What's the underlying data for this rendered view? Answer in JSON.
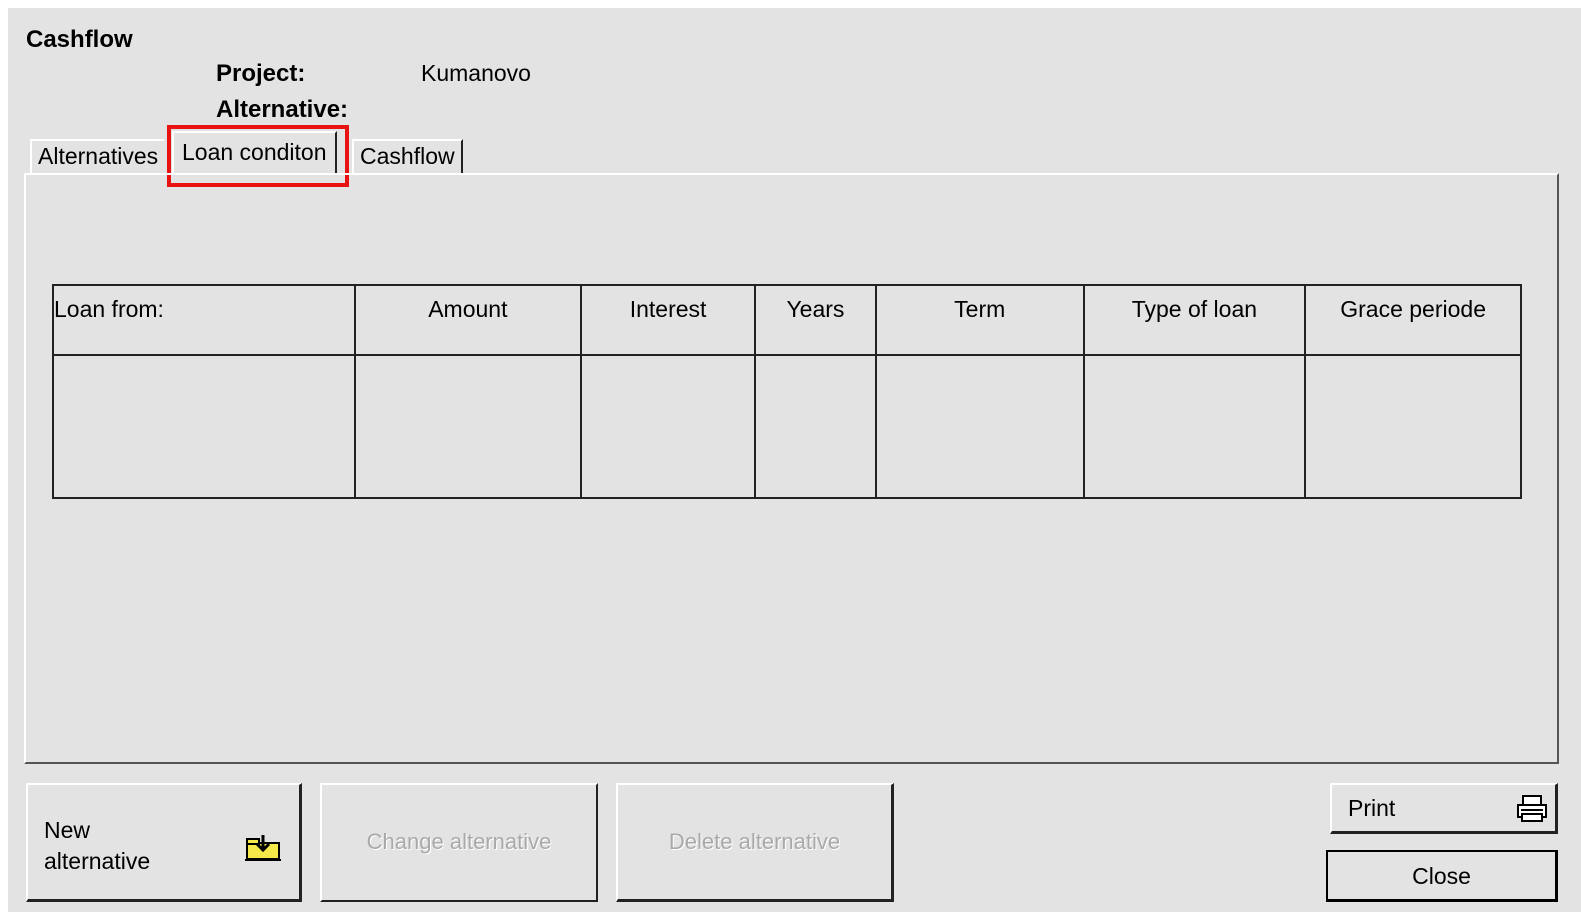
{
  "window": {
    "title": "Cashflow",
    "project_label": "Project:",
    "project_value": "Kumanovo",
    "alternative_label": "Alternative:"
  },
  "tabs": [
    {
      "label": "Alternatives"
    },
    {
      "label": "Loan conditon",
      "active": true
    },
    {
      "label": "Cashflow"
    }
  ],
  "loan_table": {
    "columns": [
      "Loan from:",
      "Amount",
      "Interest",
      "Years",
      "Term",
      "Type of loan",
      "Grace periode"
    ],
    "rows": []
  },
  "buttons": {
    "new_alternative": "New\nalternative",
    "change_alternative": "Change alternative",
    "delete_alternative": "Delete alternative",
    "print": "Print",
    "close": "Close"
  },
  "icons": {
    "new_alternative": "import-folder-icon",
    "print": "printer-icon"
  },
  "colors": {
    "background": "#e3e3e3",
    "highlight": "#e81212"
  }
}
